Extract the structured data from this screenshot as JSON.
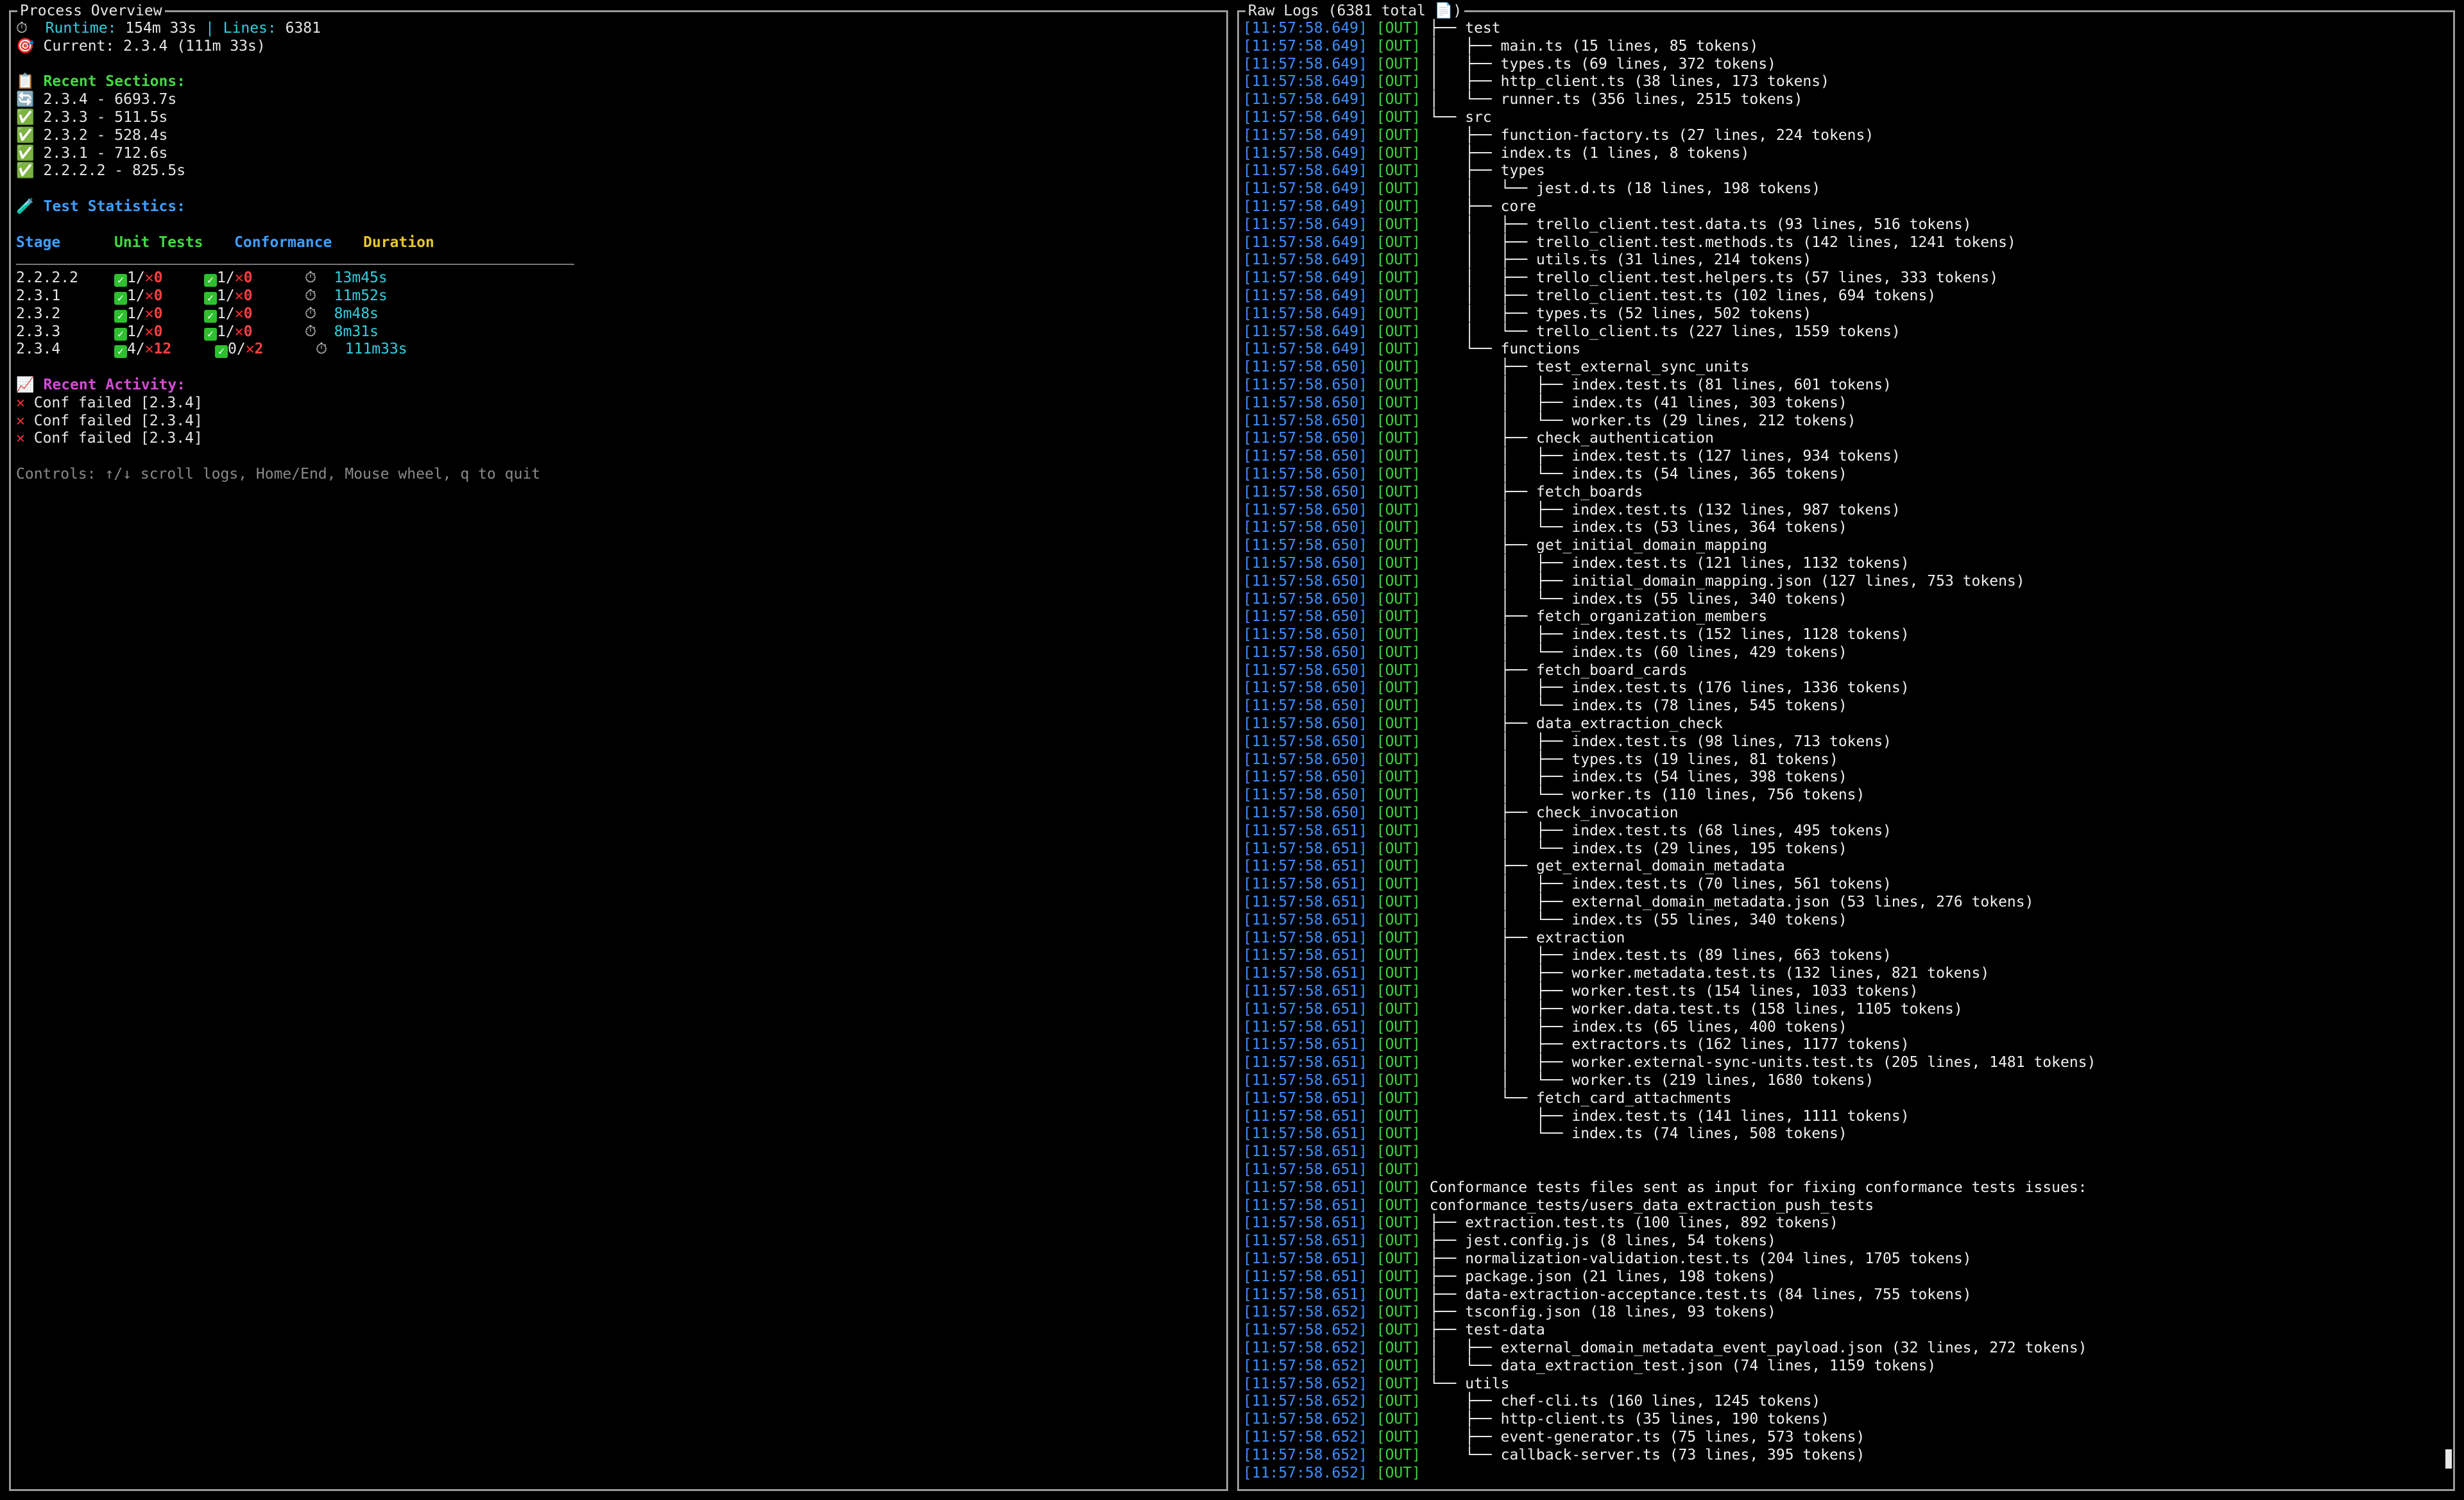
{
  "left_panel": {
    "title": "Process Overview",
    "runtime_icon": "⏱",
    "runtime_label": "Runtime:",
    "runtime_value": "154m 33s",
    "separator": "|",
    "lines_label": "Lines:",
    "lines_value": "6381",
    "current_icon": "🎯",
    "current_text": "Current: 2.3.4 (111m 33s)",
    "recent_sections_icon": "📋",
    "recent_sections_label": "Recent Sections:",
    "sections": [
      {
        "icon": "🔄",
        "text": "2.3.4 - 6693.7s"
      },
      {
        "icon": "✅",
        "text": "2.3.3 - 511.5s"
      },
      {
        "icon": "✅",
        "text": "2.3.2 - 528.4s"
      },
      {
        "icon": "✅",
        "text": "2.3.1 - 712.6s"
      },
      {
        "icon": "✅",
        "text": "2.2.2.2 - 825.5s"
      }
    ],
    "stats_icon": "🧪",
    "stats_label": "Test Statistics:",
    "headers": {
      "stage": "Stage",
      "unit": "Unit Tests",
      "conf": "Conformance",
      "duration": "Duration"
    },
    "stats": [
      {
        "stage": "2.2.2.2",
        "unit_pass": "1",
        "unit_fail": "0",
        "conf_pass": "1",
        "conf_fail": "0",
        "duration": "13m45s"
      },
      {
        "stage": "2.3.1",
        "unit_pass": "1",
        "unit_fail": "0",
        "conf_pass": "1",
        "conf_fail": "0",
        "duration": "11m52s"
      },
      {
        "stage": "2.3.2",
        "unit_pass": "1",
        "unit_fail": "0",
        "conf_pass": "1",
        "conf_fail": "0",
        "duration": "8m48s"
      },
      {
        "stage": "2.3.3",
        "unit_pass": "1",
        "unit_fail": "0",
        "conf_pass": "1",
        "conf_fail": "0",
        "duration": "8m31s"
      },
      {
        "stage": "2.3.4",
        "unit_pass": "4",
        "unit_fail": "12",
        "conf_pass": "0",
        "conf_fail": "2",
        "duration": "111m33s"
      }
    ],
    "activity_icon": "📈",
    "activity_label": "Recent Activity:",
    "activity": [
      "Conf failed [2.3.4]",
      "Conf failed [2.3.4]",
      "Conf failed [2.3.4]"
    ],
    "controls": "Controls: ↑/↓ scroll logs, Home/End, Mouse wheel, q to quit"
  },
  "right_panel": {
    "title": "Raw Logs (6381 total 📄)",
    "tag": "[OUT]",
    "logs": [
      {
        "t": "[11:57:58.649]",
        "m": "├── test"
      },
      {
        "t": "[11:57:58.649]",
        "m": "│   ├── main.ts (15 lines, 85 tokens)"
      },
      {
        "t": "[11:57:58.649]",
        "m": "│   ├── types.ts (69 lines, 372 tokens)"
      },
      {
        "t": "[11:57:58.649]",
        "m": "│   ├── http_client.ts (38 lines, 173 tokens)"
      },
      {
        "t": "[11:57:58.649]",
        "m": "│   └── runner.ts (356 lines, 2515 tokens)"
      },
      {
        "t": "[11:57:58.649]",
        "m": "└── src"
      },
      {
        "t": "[11:57:58.649]",
        "m": "    ├── function-factory.ts (27 lines, 224 tokens)"
      },
      {
        "t": "[11:57:58.649]",
        "m": "    ├── index.ts (1 lines, 8 tokens)"
      },
      {
        "t": "[11:57:58.649]",
        "m": "    ├── types"
      },
      {
        "t": "[11:57:58.649]",
        "m": "    │   └── jest.d.ts (18 lines, 198 tokens)"
      },
      {
        "t": "[11:57:58.649]",
        "m": "    ├── core"
      },
      {
        "t": "[11:57:58.649]",
        "m": "    │   ├── trello_client.test.data.ts (93 lines, 516 tokens)"
      },
      {
        "t": "[11:57:58.649]",
        "m": "    │   ├── trello_client.test.methods.ts (142 lines, 1241 tokens)"
      },
      {
        "t": "[11:57:58.649]",
        "m": "    │   ├── utils.ts (31 lines, 214 tokens)"
      },
      {
        "t": "[11:57:58.649]",
        "m": "    │   ├── trello_client.test.helpers.ts (57 lines, 333 tokens)"
      },
      {
        "t": "[11:57:58.649]",
        "m": "    │   ├── trello_client.test.ts (102 lines, 694 tokens)"
      },
      {
        "t": "[11:57:58.649]",
        "m": "    │   ├── types.ts (52 lines, 502 tokens)"
      },
      {
        "t": "[11:57:58.649]",
        "m": "    │   └── trello_client.ts (227 lines, 1559 tokens)"
      },
      {
        "t": "[11:57:58.649]",
        "m": "    └── functions"
      },
      {
        "t": "[11:57:58.650]",
        "m": "        ├── test_external_sync_units"
      },
      {
        "t": "[11:57:58.650]",
        "m": "        │   ├── index.test.ts (81 lines, 601 tokens)"
      },
      {
        "t": "[11:57:58.650]",
        "m": "        │   ├── index.ts (41 lines, 303 tokens)"
      },
      {
        "t": "[11:57:58.650]",
        "m": "        │   └── worker.ts (29 lines, 212 tokens)"
      },
      {
        "t": "[11:57:58.650]",
        "m": "        ├── check_authentication"
      },
      {
        "t": "[11:57:58.650]",
        "m": "        │   ├── index.test.ts (127 lines, 934 tokens)"
      },
      {
        "t": "[11:57:58.650]",
        "m": "        │   └── index.ts (54 lines, 365 tokens)"
      },
      {
        "t": "[11:57:58.650]",
        "m": "        ├── fetch_boards"
      },
      {
        "t": "[11:57:58.650]",
        "m": "        │   ├── index.test.ts (132 lines, 987 tokens)"
      },
      {
        "t": "[11:57:58.650]",
        "m": "        │   └── index.ts (53 lines, 364 tokens)"
      },
      {
        "t": "[11:57:58.650]",
        "m": "        ├── get_initial_domain_mapping"
      },
      {
        "t": "[11:57:58.650]",
        "m": "        │   ├── index.test.ts (121 lines, 1132 tokens)"
      },
      {
        "t": "[11:57:58.650]",
        "m": "        │   ├── initial_domain_mapping.json (127 lines, 753 tokens)"
      },
      {
        "t": "[11:57:58.650]",
        "m": "        │   └── index.ts (55 lines, 340 tokens)"
      },
      {
        "t": "[11:57:58.650]",
        "m": "        ├── fetch_organization_members"
      },
      {
        "t": "[11:57:58.650]",
        "m": "        │   ├── index.test.ts (152 lines, 1128 tokens)"
      },
      {
        "t": "[11:57:58.650]",
        "m": "        │   └── index.ts (60 lines, 429 tokens)"
      },
      {
        "t": "[11:57:58.650]",
        "m": "        ├── fetch_board_cards"
      },
      {
        "t": "[11:57:58.650]",
        "m": "        │   ├── index.test.ts (176 lines, 1336 tokens)"
      },
      {
        "t": "[11:57:58.650]",
        "m": "        │   └── index.ts (78 lines, 545 tokens)"
      },
      {
        "t": "[11:57:58.650]",
        "m": "        ├── data_extraction_check"
      },
      {
        "t": "[11:57:58.650]",
        "m": "        │   ├── index.test.ts (98 lines, 713 tokens)"
      },
      {
        "t": "[11:57:58.650]",
        "m": "        │   ├── types.ts (19 lines, 81 tokens)"
      },
      {
        "t": "[11:57:58.650]",
        "m": "        │   ├── index.ts (54 lines, 398 tokens)"
      },
      {
        "t": "[11:57:58.650]",
        "m": "        │   └── worker.ts (110 lines, 756 tokens)"
      },
      {
        "t": "[11:57:58.650]",
        "m": "        ├── check_invocation"
      },
      {
        "t": "[11:57:58.651]",
        "m": "        │   ├── index.test.ts (68 lines, 495 tokens)"
      },
      {
        "t": "[11:57:58.651]",
        "m": "        │   └── index.ts (29 lines, 195 tokens)"
      },
      {
        "t": "[11:57:58.651]",
        "m": "        ├── get_external_domain_metadata"
      },
      {
        "t": "[11:57:58.651]",
        "m": "        │   ├── index.test.ts (70 lines, 561 tokens)"
      },
      {
        "t": "[11:57:58.651]",
        "m": "        │   ├── external_domain_metadata.json (53 lines, 276 tokens)"
      },
      {
        "t": "[11:57:58.651]",
        "m": "        │   └── index.ts (55 lines, 340 tokens)"
      },
      {
        "t": "[11:57:58.651]",
        "m": "        ├── extraction"
      },
      {
        "t": "[11:57:58.651]",
        "m": "        │   ├── index.test.ts (89 lines, 663 tokens)"
      },
      {
        "t": "[11:57:58.651]",
        "m": "        │   ├── worker.metadata.test.ts (132 lines, 821 tokens)"
      },
      {
        "t": "[11:57:58.651]",
        "m": "        │   ├── worker.test.ts (154 lines, 1033 tokens)"
      },
      {
        "t": "[11:57:58.651]",
        "m": "        │   ├── worker.data.test.ts (158 lines, 1105 tokens)"
      },
      {
        "t": "[11:57:58.651]",
        "m": "        │   ├── index.ts (65 lines, 400 tokens)"
      },
      {
        "t": "[11:57:58.651]",
        "m": "        │   ├── extractors.ts (162 lines, 1177 tokens)"
      },
      {
        "t": "[11:57:58.651]",
        "m": "        │   ├── worker.external-sync-units.test.ts (205 lines, 1481 tokens)"
      },
      {
        "t": "[11:57:58.651]",
        "m": "        │   └── worker.ts (219 lines, 1680 tokens)"
      },
      {
        "t": "[11:57:58.651]",
        "m": "        └── fetch_card_attachments"
      },
      {
        "t": "[11:57:58.651]",
        "m": "            ├── index.test.ts (141 lines, 1111 tokens)"
      },
      {
        "t": "[11:57:58.651]",
        "m": "            └── index.ts (74 lines, 508 tokens)"
      },
      {
        "t": "[11:57:58.651]",
        "m": ""
      },
      {
        "t": "[11:57:58.651]",
        "m": ""
      },
      {
        "t": "[11:57:58.651]",
        "m": "Conformance tests files sent as input for fixing conformance tests issues:"
      },
      {
        "t": "[11:57:58.651]",
        "m": "conformance_tests/users_data_extraction_push_tests"
      },
      {
        "t": "[11:57:58.651]",
        "m": "├── extraction.test.ts (100 lines, 892 tokens)"
      },
      {
        "t": "[11:57:58.651]",
        "m": "├── jest.config.js (8 lines, 54 tokens)"
      },
      {
        "t": "[11:57:58.651]",
        "m": "├── normalization-validation.test.ts (204 lines, 1705 tokens)"
      },
      {
        "t": "[11:57:58.651]",
        "m": "├── package.json (21 lines, 198 tokens)"
      },
      {
        "t": "[11:57:58.651]",
        "m": "├── data-extraction-acceptance.test.ts (84 lines, 755 tokens)"
      },
      {
        "t": "[11:57:58.652]",
        "m": "├── tsconfig.json (18 lines, 93 tokens)"
      },
      {
        "t": "[11:57:58.652]",
        "m": "├── test-data"
      },
      {
        "t": "[11:57:58.652]",
        "m": "│   ├── external_domain_metadata_event_payload.json (32 lines, 272 tokens)"
      },
      {
        "t": "[11:57:58.652]",
        "m": "│   └── data_extraction_test.json (74 lines, 1159 tokens)"
      },
      {
        "t": "[11:57:58.652]",
        "m": "└── utils"
      },
      {
        "t": "[11:57:58.652]",
        "m": "    ├── chef-cli.ts (160 lines, 1245 tokens)"
      },
      {
        "t": "[11:57:58.652]",
        "m": "    ├── http-client.ts (35 lines, 190 tokens)"
      },
      {
        "t": "[11:57:58.652]",
        "m": "    ├── event-generator.ts (75 lines, 573 tokens)"
      },
      {
        "t": "[11:57:58.652]",
        "m": "    └── callback-server.ts (73 lines, 395 tokens)"
      },
      {
        "t": "[11:57:58.652]",
        "m": ""
      }
    ]
  }
}
